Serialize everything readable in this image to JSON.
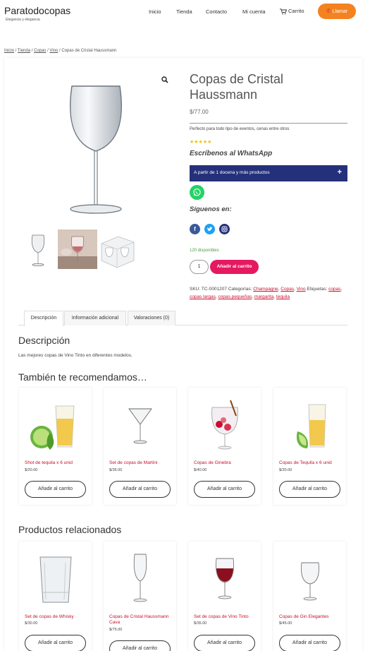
{
  "site": {
    "title": "Paratodocopas",
    "tagline": "Elegancia y elegancia"
  },
  "nav": {
    "home": "Inicio",
    "shop": "Tienda",
    "contact": "Contacto",
    "account": "Mi cuenta",
    "cart": "Carrito"
  },
  "call_button": "Llamar",
  "breadcrumb": {
    "home": "Inicio",
    "shop": "Tienda",
    "copas": "Copas",
    "vino": "Vino",
    "sep": " / ",
    "current": "Copas de Cristal Haussmann"
  },
  "product": {
    "title": "Copas de Cristal Haussmann",
    "price": "$/77.00",
    "short_description": "Perfecto para todo tipo de eventos, cenas entre otros",
    "rating_stars": "★★★★★",
    "whatsapp_heading": "Escríbenos al WhatsApp",
    "accordion_label": "A partir de 1 docena y más productos",
    "accordion_toggle": "+",
    "follow_heading": "Síguenos en:",
    "stock": "120 disponibles",
    "quantity": "1",
    "add_to_cart": "Añadir al carrito",
    "sku_label": "SKU:",
    "sku": "TC-0001207",
    "categories_label": "Categorías:",
    "categories": [
      "Champagne",
      "Copas",
      "Vino"
    ],
    "tags_label": "Etiquetas:",
    "tags": [
      "copas",
      "copas largas",
      "copas pequeñas",
      "margarita",
      "tequila"
    ]
  },
  "tabs": [
    "Descripción",
    "Información adicional",
    "Valoraciones (0)"
  ],
  "description": {
    "heading": "Descripción",
    "text": "Las mejores copas de Vino Tinto en diferentes modelos."
  },
  "recommend": {
    "heading": "También te recomendamos…",
    "items": [
      {
        "name": "Shot de tequila x 6 unid",
        "price": "$/20.00",
        "button": "Añadir al carrito"
      },
      {
        "name": "Set de copas de Martini",
        "price": "$/35.00",
        "button": "Añadir al carrito"
      },
      {
        "name": "Copas de Ginebra",
        "price": "$/40.00",
        "button": "Añadir al carrito"
      },
      {
        "name": "Copas de Tequila x 6 unid",
        "price": "$/20.00",
        "button": "Añadir al carrito"
      }
    ]
  },
  "related": {
    "heading": "Productos relacionados",
    "items": [
      {
        "name": "Set de copas de Whisky",
        "price": "$/30.00",
        "button": "Añadir al carrito"
      },
      {
        "name": "Copas de Cristal Haussmann Cava",
        "price": "$/75.00",
        "button": "Añadir al carrito"
      },
      {
        "name": "Set de copas de Vino Tinto",
        "price": "$/35.00",
        "button": "Añadir al carrito"
      },
      {
        "name": "Copas de Gin Elegantes",
        "price": "$/45.00",
        "button": "Añadir al carrito"
      }
    ]
  },
  "colors": {
    "accent_orange": "#f58220",
    "add_to_cart_pink": "#e5195f",
    "accordion_navy": "#25307a",
    "whatsapp_green": "#25d366",
    "link_red": "#c8102e",
    "stars_gold": "#f2c200"
  },
  "icons": {
    "zoom": "search-icon",
    "cart": "cart-icon",
    "phone": "phone-icon",
    "whatsapp": "whatsapp-icon",
    "facebook": "facebook-icon",
    "twitter": "twitter-icon",
    "instagram": "instagram-icon"
  }
}
